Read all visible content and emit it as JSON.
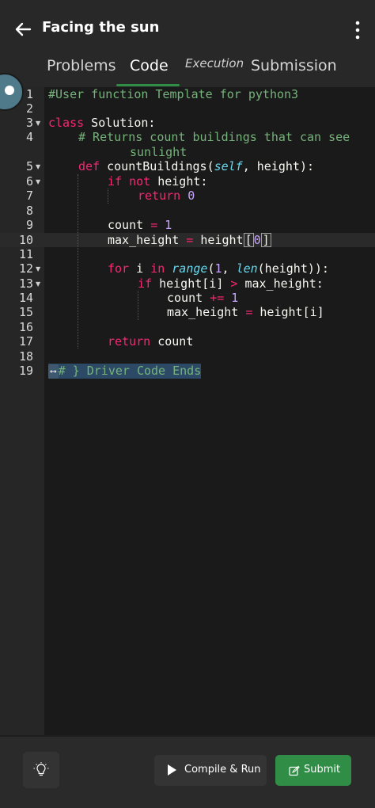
{
  "header": {
    "title": "Facing the sun",
    "back_icon": "arrow-left-icon",
    "menu_icon": "more-vertical-icon"
  },
  "tabs": [
    {
      "label": "Problems",
      "active": false
    },
    {
      "label": "Code",
      "active": true
    },
    {
      "label": "Execution",
      "active": false
    },
    {
      "label": "Submission",
      "active": false
    }
  ],
  "editor": {
    "line_numbers": [
      "1",
      "2",
      "3",
      "4",
      "5",
      "6",
      "7",
      "8",
      "9",
      "10",
      "11",
      "12",
      "13",
      "14",
      "15",
      "16",
      "17",
      "18",
      "19"
    ],
    "current_line": "10",
    "code": {
      "l1": "#User function Template for python3",
      "l3_kw": "class",
      "l3_rest": " Solution:",
      "l4a": "# Returns count buildings that can see",
      "l4b": "sunlight",
      "l5_kw": "def",
      "l5_fn": "countBuildings",
      "l5_self": "self",
      "l5_rest": ", height):",
      "l6_kw1": "if",
      "l6_kw2": "not",
      "l6_rest": " height:",
      "l7_kw": "return",
      "l7_num": "0",
      "l9_var": "count",
      "l9_op": "=",
      "l9_num": "1",
      "l10_var": "max_height",
      "l10_op": "=",
      "l10_rest": "height",
      "l10_num": "0",
      "l12_kw1": "for",
      "l12_var": "i",
      "l12_kw2": "in",
      "l12_fn": "range",
      "l12_num": "1",
      "l12_fn2": "len",
      "l12_rest": "(height)):",
      "l13_kw": "if",
      "l13_a": "height[i]",
      "l13_op": ">",
      "l13_b": "max_height:",
      "l14_var": "count",
      "l14_op": "+=",
      "l14_num": "1",
      "l15_var": "max_height",
      "l15_op": "=",
      "l15_rest": "height[i]",
      "l17_kw": "return",
      "l17_rest": " count",
      "l19_marker": "⟷",
      "l19": "# } Driver Code Ends"
    }
  },
  "footer": {
    "theme_icon": "lightbulb-icon",
    "run_label": "Compile & Run",
    "submit_label": "Submit",
    "accent": "#2f8d46"
  }
}
